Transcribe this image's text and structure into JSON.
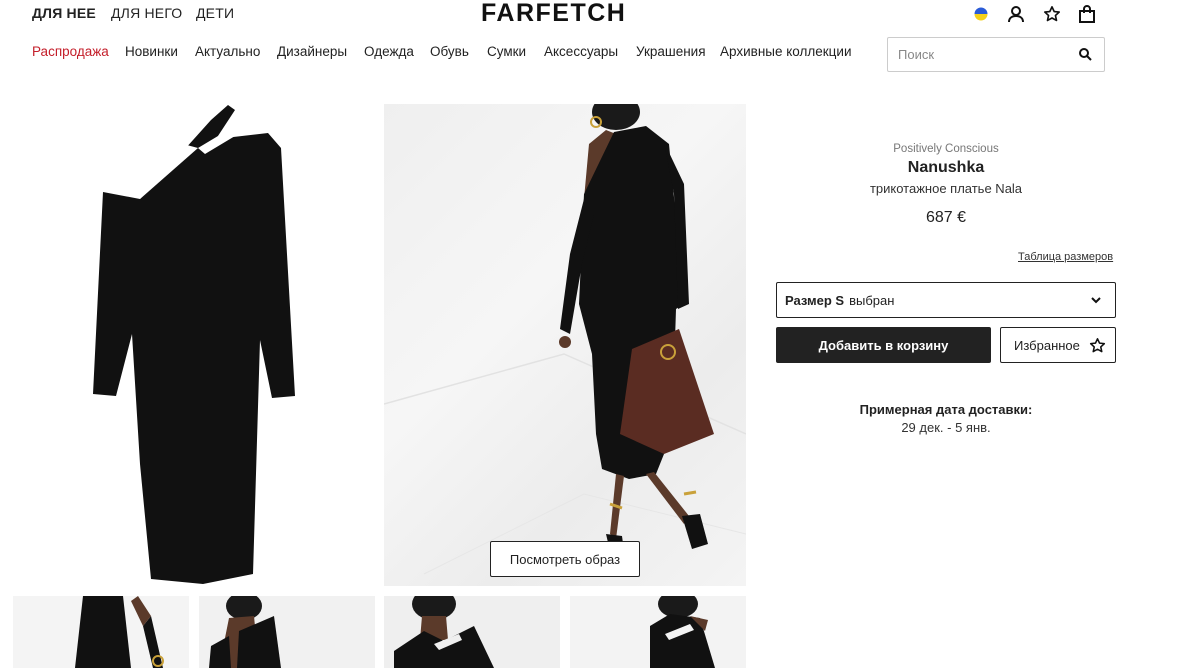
{
  "header": {
    "genders": [
      {
        "label": "ДЛЯ НЕЕ",
        "active": true
      },
      {
        "label": "ДЛЯ НЕГО",
        "active": false
      },
      {
        "label": "ДЕТИ",
        "active": false
      }
    ],
    "logo": "FARFETCH",
    "icons": [
      "ukraine-flag-icon",
      "user-icon",
      "star-icon",
      "shopping-bag-icon"
    ]
  },
  "nav": {
    "categories": [
      "Распродажа",
      "Новинки",
      "Актуально",
      "Дизайнеры",
      "Одежда",
      "Обувь",
      "Сумки",
      "Аксессуары",
      "Украшения",
      "Архивные коллекции"
    ],
    "sale_color": "#c41e2a"
  },
  "search": {
    "placeholder": "Поиск",
    "value": ""
  },
  "gallery": {
    "view_look_label": "Посмотреть образ"
  },
  "product": {
    "tagline": "Positively Conscious",
    "brand": "Nanushka",
    "name": "трикотажное платье Nala",
    "price": "687 €",
    "size_chart_label": "Таблица размеров",
    "size_label": "Размер S",
    "size_state": "выбран",
    "add_to_cart": "Добавить в корзину",
    "wishlist": "Избранное"
  },
  "delivery": {
    "label": "Примерная дата доставки:",
    "dates": "29 дек. - 5 янв."
  },
  "colors": {
    "dress": "#111111",
    "bag": "#5a2c22"
  }
}
